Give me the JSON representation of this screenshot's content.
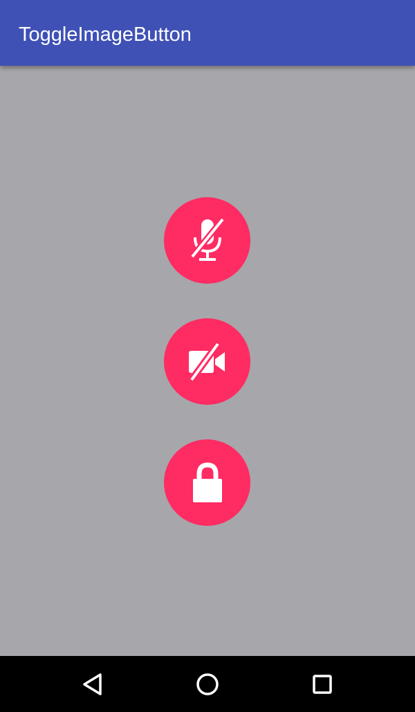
{
  "app_bar": {
    "title": "ToggleImageButton",
    "color": "#3f51b5"
  },
  "content": {
    "background": "#a7a6aa",
    "buttons": [
      {
        "icon": "mic-off-icon",
        "state": "off"
      },
      {
        "icon": "videocam-off-icon",
        "state": "off"
      },
      {
        "icon": "lock-icon",
        "state": "locked"
      }
    ],
    "button_color": "#ff2b63"
  },
  "nav_bar": {
    "items": [
      {
        "icon": "back-icon"
      },
      {
        "icon": "home-icon"
      },
      {
        "icon": "recents-icon"
      }
    ]
  }
}
